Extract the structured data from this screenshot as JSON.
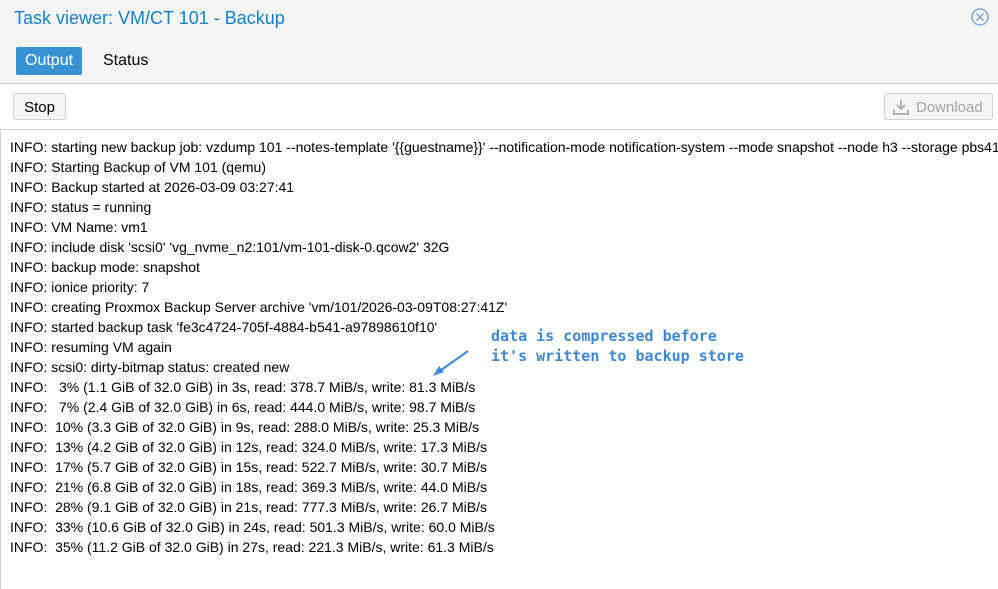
{
  "window": {
    "title": "Task viewer: VM/CT 101 - Backup",
    "close_icon": "close-circle-icon"
  },
  "tabs": [
    {
      "label": "Output",
      "active": true
    },
    {
      "label": "Status",
      "active": false
    }
  ],
  "toolbar": {
    "stop_label": "Stop",
    "download_label": "Download",
    "download_icon": "download-icon",
    "download_enabled": false
  },
  "log": [
    "INFO: starting new backup job: vzdump 101 --notes-template '{{guestname}}' --notification-mode notification-system --mode snapshot --node h3 --storage pbs41",
    "INFO: Starting Backup of VM 101 (qemu)",
    "INFO: Backup started at 2026-03-09 03:27:41",
    "INFO: status = running",
    "INFO: VM Name: vm1",
    "INFO: include disk 'scsi0' 'vg_nvme_n2:101/vm-101-disk-0.qcow2' 32G",
    "INFO: backup mode: snapshot",
    "INFO: ionice priority: 7",
    "INFO: creating Proxmox Backup Server archive 'vm/101/2026-03-09T08:27:41Z'",
    "INFO: started backup task 'fe3c4724-705f-4884-b541-a97898610f10'",
    "INFO: resuming VM again",
    "INFO: scsi0: dirty-bitmap status: created new",
    "INFO:   3% (1.1 GiB of 32.0 GiB) in 3s, read: 378.7 MiB/s, write: 81.3 MiB/s",
    "INFO:   7% (2.4 GiB of 32.0 GiB) in 6s, read: 444.0 MiB/s, write: 98.7 MiB/s",
    "INFO:  10% (3.3 GiB of 32.0 GiB) in 9s, read: 288.0 MiB/s, write: 25.3 MiB/s",
    "INFO:  13% (4.2 GiB of 32.0 GiB) in 12s, read: 324.0 MiB/s, write: 17.3 MiB/s",
    "INFO:  17% (5.7 GiB of 32.0 GiB) in 15s, read: 522.7 MiB/s, write: 30.7 MiB/s",
    "INFO:  21% (6.8 GiB of 32.0 GiB) in 18s, read: 369.3 MiB/s, write: 44.0 MiB/s",
    "INFO:  28% (9.1 GiB of 32.0 GiB) in 21s, read: 777.3 MiB/s, write: 26.7 MiB/s",
    "INFO:  33% (10.6 GiB of 32.0 GiB) in 24s, read: 501.3 MiB/s, write: 60.0 MiB/s",
    "INFO:  35% (11.2 GiB of 32.0 GiB) in 27s, read: 221.3 MiB/s, write: 61.3 MiB/s"
  ],
  "annotation": {
    "lines": [
      "data is compressed before",
      "it's written to backup store"
    ],
    "color": "#3f87d6"
  },
  "colors": {
    "accent": "#157fcc",
    "active_tab": "#3892d4"
  }
}
